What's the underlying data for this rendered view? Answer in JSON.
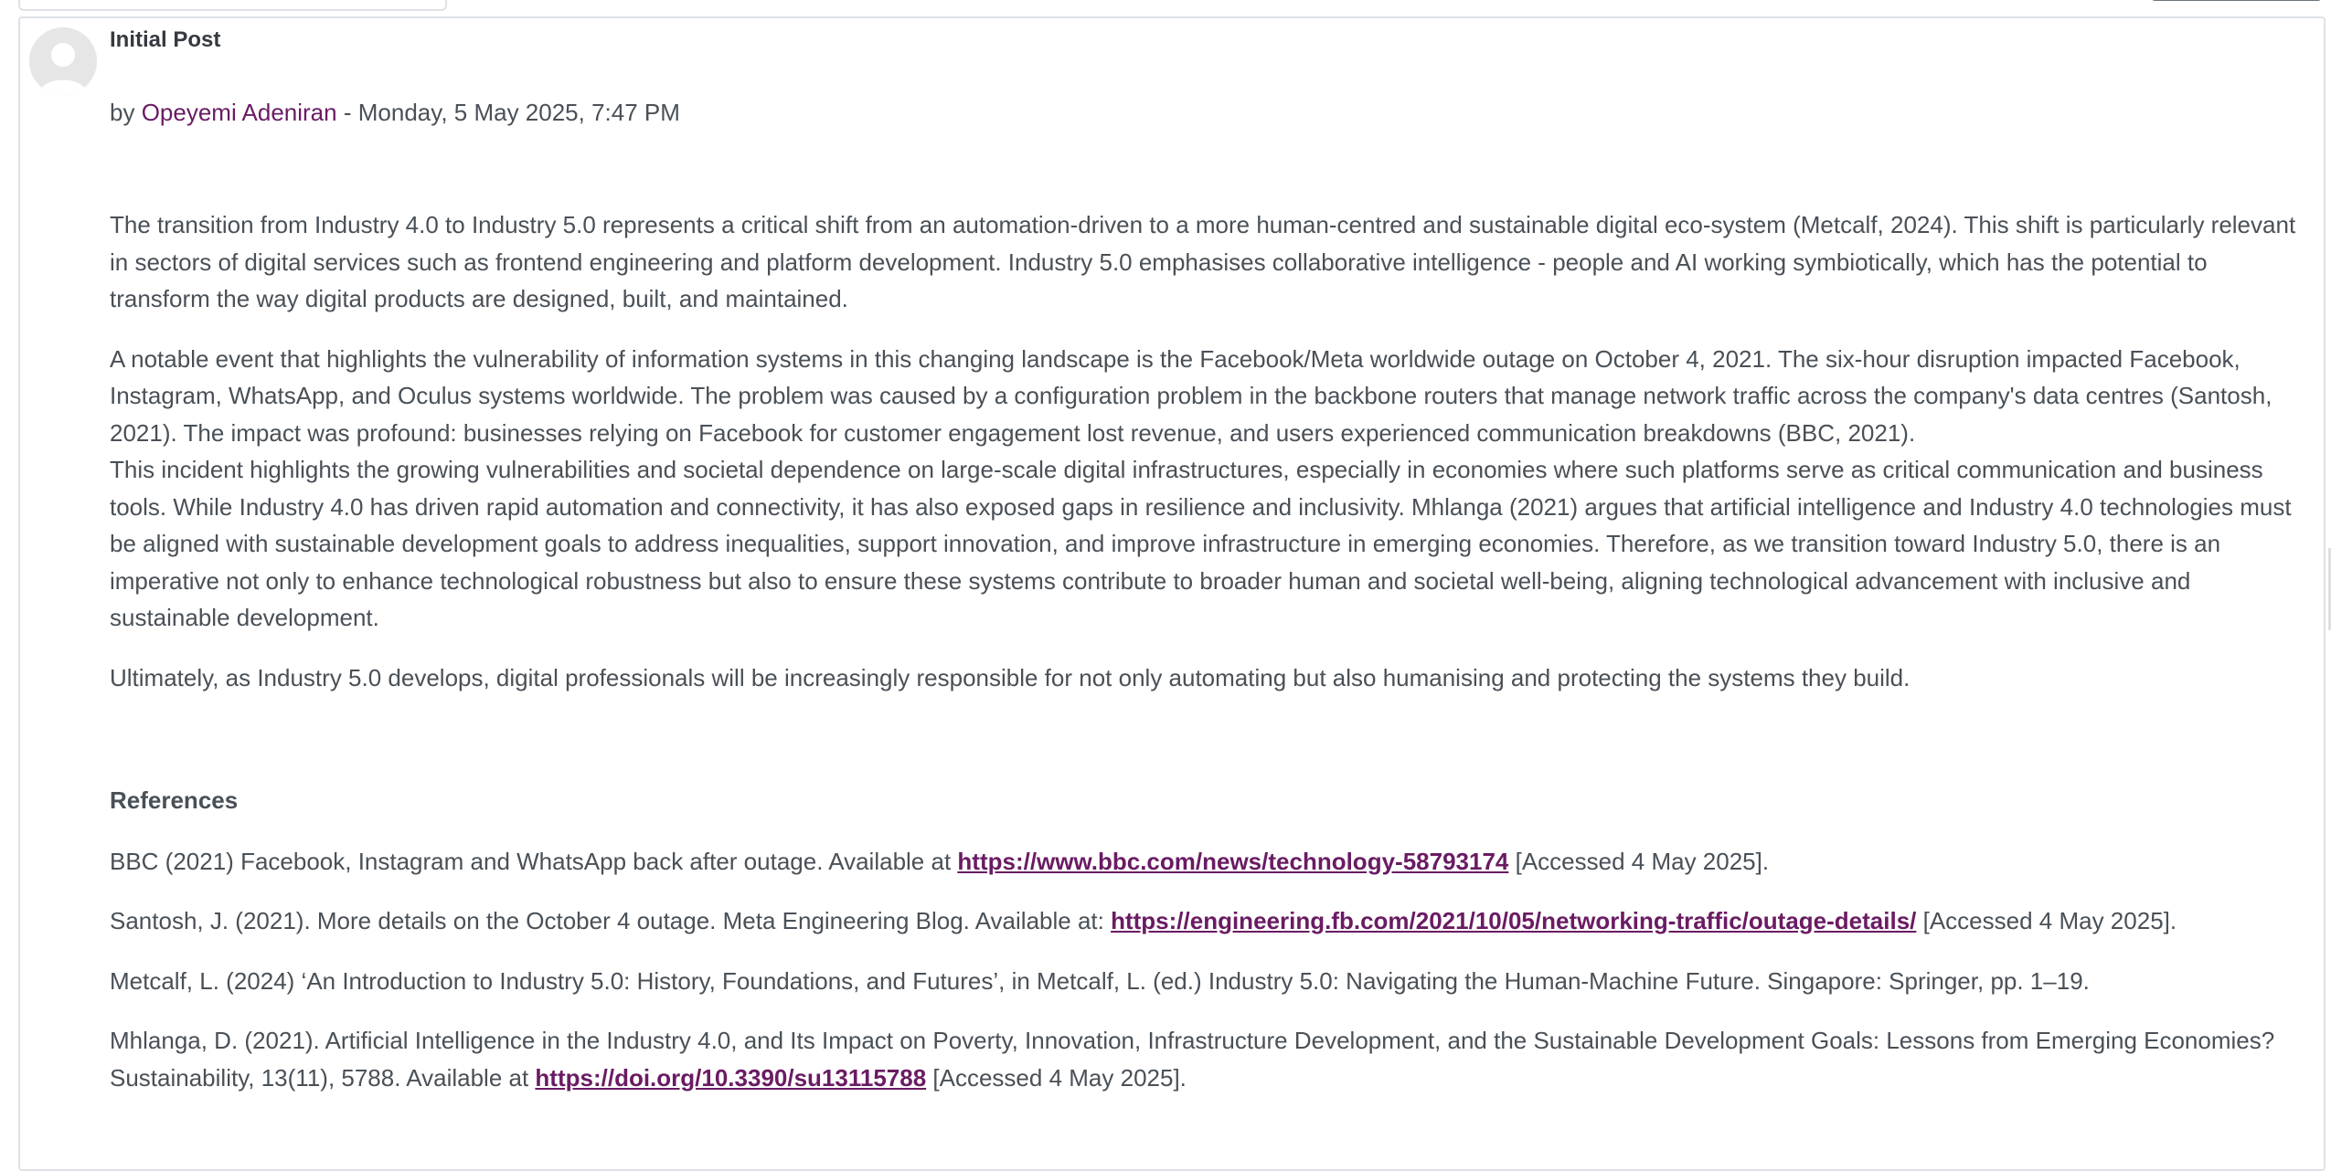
{
  "post": {
    "title": "Initial Post",
    "meta": {
      "by_prefix": "by",
      "author": "Opeyemi Adeniran",
      "separator": "-",
      "datetime": "Monday, 5 May 2025, 7:47 PM"
    },
    "paragraphs": [
      "The transition from Industry 4.0 to Industry 5.0 represents a critical shift from an automation-driven to a more human-centred and sustainable digital eco-system (Metcalf, 2024). This shift is particularly relevant in sectors of digital services such as frontend engineering and platform development. Industry 5.0 emphasises collaborative intelligence - people and AI working symbiotically, which has the potential to transform the way digital products are designed, built, and maintained.",
      "A notable event that highlights the vulnerability of information systems in this changing landscape is the Facebook/Meta worldwide outage on October 4, 2021. The six-hour disruption impacted Facebook, Instagram, WhatsApp, and Oculus systems worldwide. The problem was caused by a configuration problem in the backbone routers that manage network traffic across the company's data centres (Santosh, 2021). The impact was profound: businesses relying on Facebook for customer engagement lost revenue, and users experienced communication breakdowns (BBC, 2021).",
      "This incident highlights the growing vulnerabilities and societal dependence on large-scale digital infrastructures, especially in economies where such platforms serve as critical communication and business tools. While Industry 4.0 has driven rapid automation and connectivity, it has also exposed gaps in resilience and inclusivity. Mhlanga (2021) argues that artificial intelligence and Industry 4.0 technologies must be aligned with sustainable development goals to address inequalities, support innovation, and improve infrastructure in emerging economies. Therefore, as we transition toward Industry 5.0, there is an imperative not only to enhance technological robustness but also to ensure these systems contribute to broader human and societal well-being, aligning technological advancement with inclusive and sustainable development.",
      "Ultimately, as Industry 5.0 develops, digital professionals will be increasingly responsible for not only automating but also humanising and protecting the systems they build."
    ],
    "references": {
      "heading": "References",
      "items": [
        {
          "before": "BBC (2021) Facebook, Instagram and WhatsApp back after outage. Available at ",
          "link": "https://www.bbc.com/news/technology-58793174",
          "after": " [Accessed 4 May 2025]."
        },
        {
          "before": "Santosh, J. (2021). More details on the October 4 outage. Meta Engineering Blog. Available at: ",
          "link": "https://engineering.fb.com/2021/10/05/networking-traffic/outage-details/",
          "after": " [Accessed 4 May 2025]."
        },
        {
          "before": "Metcalf, L. (2024) ‘An Introduction to Industry 5.0: History, Foundations, and Futures’, in Metcalf, L. (ed.) Industry 5.0: Navigating the Human-Machine Future. Singapore: Springer, pp. 1–19.",
          "link": "",
          "after": ""
        },
        {
          "before": "Mhlanga, D. (2021). Artificial Intelligence in the Industry 4.0, and Its Impact on Poverty, Innovation, Infrastructure Development, and the Sustainable Development Goals: Lessons from Emerging Economies? Sustainability, 13(11), 5788. Available at ",
          "link": "https://doi.org/10.3390/su13115788",
          "after": " [Accessed 4 May 2025]."
        }
      ]
    }
  },
  "colors": {
    "text": "#495057",
    "link": "#6a1b63",
    "border": "#dee2e6",
    "avatar": "#e6e6e6"
  },
  "icons": {
    "avatar": "user-placeholder-icon"
  }
}
